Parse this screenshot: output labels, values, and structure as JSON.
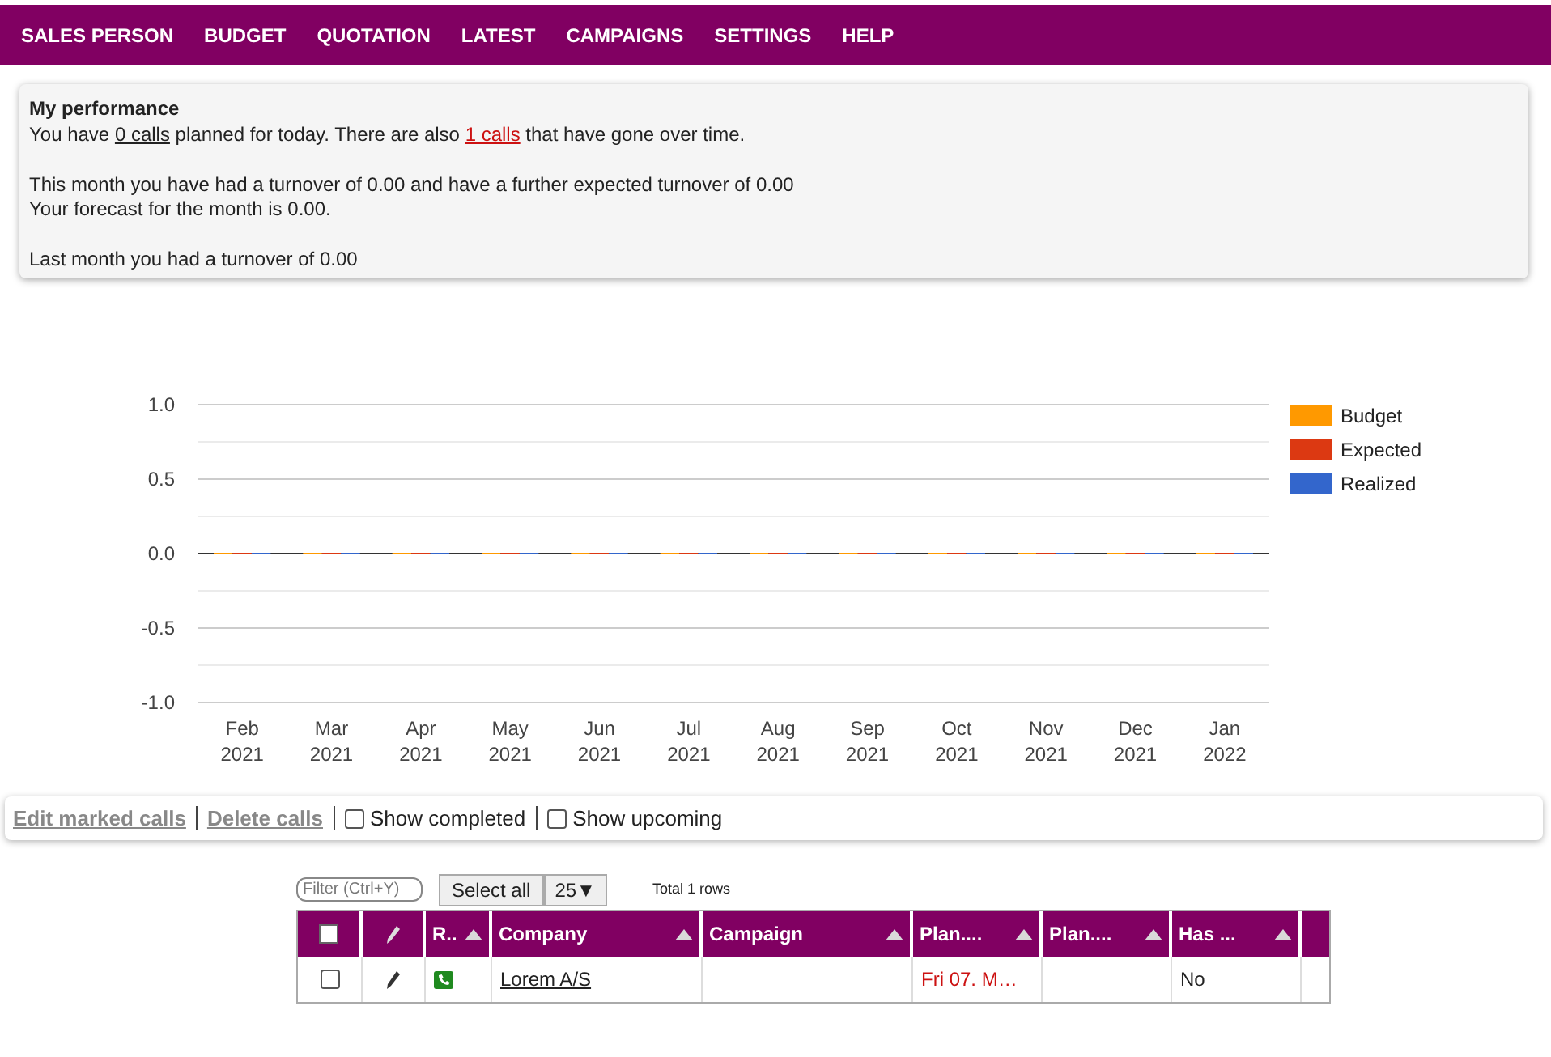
{
  "nav": [
    {
      "label": "SALES PERSON"
    },
    {
      "label": "BUDGET"
    },
    {
      "label": "QUOTATION"
    },
    {
      "label": "LATEST"
    },
    {
      "label": "CAMPAIGNS"
    },
    {
      "label": "SETTINGS"
    },
    {
      "label": "HELP"
    }
  ],
  "performance": {
    "title": "My performance",
    "paragraphs": [
      {
        "lines": [
          [
            {
              "kind": "text",
              "text": "You have "
            },
            {
              "kind": "link",
              "text": "0 calls",
              "overdue": false
            },
            {
              "kind": "text",
              "text": " planned for today. There are also "
            },
            {
              "kind": "link",
              "text": "1 calls",
              "overdue": true
            },
            {
              "kind": "text",
              "text": " that have gone over time."
            }
          ]
        ]
      },
      {
        "lines": [
          [
            {
              "kind": "text",
              "text": "This month you have had a turnover of 0.00 and have a further expected turnover of 0.00"
            }
          ],
          [
            {
              "kind": "text",
              "text": "Your forecast for the month is 0.00."
            }
          ]
        ]
      },
      {
        "lines": [
          [
            {
              "kind": "text",
              "text": "Last month you had a turnover of 0.00"
            }
          ]
        ]
      }
    ]
  },
  "chart_data": {
    "type": "bar",
    "legend": "right",
    "categories": [
      "Feb 2021",
      "Mar 2021",
      "Apr 2021",
      "May 2021",
      "Jun 2021",
      "Jul 2021",
      "Aug 2021",
      "Sep 2021",
      "Oct 2021",
      "Nov 2021",
      "Dec 2021",
      "Jan 2022"
    ],
    "ylim": [
      -1,
      1
    ],
    "yticks": [
      {
        "value": 1,
        "label": "1.0"
      },
      {
        "value": 0.5,
        "label": "0.5"
      },
      {
        "value": 0,
        "label": "0.0"
      },
      {
        "value": -0.5,
        "label": "-0.5"
      },
      {
        "value": -1,
        "label": "-1.0"
      }
    ],
    "series": [
      {
        "name": "Budget",
        "color": "#ff9900",
        "values": [
          0,
          0,
          0,
          0,
          0,
          0,
          0,
          0,
          0,
          0,
          0,
          0
        ]
      },
      {
        "name": "Expected",
        "color": "#dc3912",
        "values": [
          0,
          0,
          0,
          0,
          0,
          0,
          0,
          0,
          0,
          0,
          0,
          0
        ]
      },
      {
        "name": "Realized",
        "color": "#3366cc",
        "values": [
          0,
          0,
          0,
          0,
          0,
          0,
          0,
          0,
          0,
          0,
          0,
          0
        ]
      }
    ]
  },
  "toolbar": {
    "links": [
      {
        "label": "Edit marked calls"
      },
      {
        "label": "Delete calls"
      }
    ],
    "options": [
      {
        "label": "Show completed",
        "checked": false
      },
      {
        "label": "Show upcoming",
        "checked": false
      }
    ]
  },
  "grid": {
    "filter": {
      "placeholder": "Filter (Ctrl+Y)"
    },
    "select_all": "Select all",
    "page_size": "25▼",
    "total": "Total 1 rows",
    "columns": [
      {
        "kind": "check",
        "checked": false
      },
      {
        "kind": "edit"
      },
      {
        "kind": "text",
        "label": "R.."
      },
      {
        "kind": "text",
        "label": "Company"
      },
      {
        "kind": "text",
        "label": "Campaign"
      },
      {
        "kind": "text",
        "label": "Plan...."
      },
      {
        "kind": "text",
        "label": "Plan...."
      },
      {
        "kind": "text",
        "label": "Has ..."
      }
    ],
    "rows": [
      {
        "cells": [
          {
            "kind": "check",
            "checked": false
          },
          {
            "kind": "edit"
          },
          {
            "kind": "phone"
          },
          {
            "kind": "link",
            "text": "Lorem A/S"
          },
          {
            "kind": "text",
            "text": ""
          },
          {
            "kind": "date",
            "text": "Fri 07. M…"
          },
          {
            "kind": "text",
            "text": ""
          },
          {
            "kind": "text",
            "text": "No"
          }
        ]
      }
    ]
  }
}
